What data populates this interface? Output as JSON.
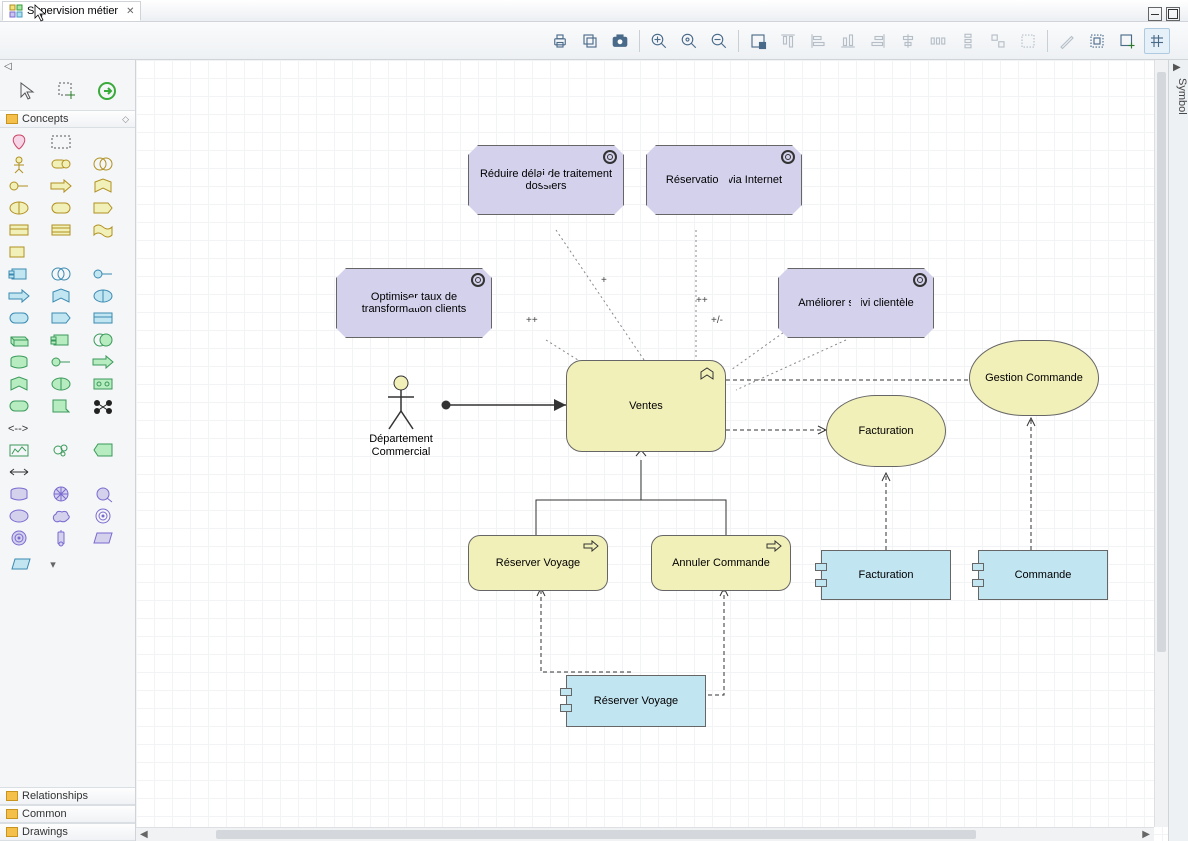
{
  "tab": {
    "title": "Supervision métier"
  },
  "symbol_panel": "Symbol",
  "palette": {
    "concepts": "Concepts",
    "relationships": "Relationships",
    "common": "Common",
    "drawings": "Drawings"
  },
  "annotations": {
    "plus1": "+",
    "plusplus1": "++",
    "plusplus2": "++",
    "plusminus": "+/-"
  },
  "nodes": {
    "goal_reduire": "Réduire délai de traitement dossiers",
    "goal_reservation": "Réservation via Internet",
    "goal_optimiser": "Optimiser taux de transformation clients",
    "goal_ameliorer": "Améliorer suivi clientèle",
    "actor_dept": "Département Commercial",
    "proc_ventes": "Ventes",
    "proc_reserver": "Réserver Voyage",
    "proc_annuler": "Annuler Commande",
    "serv_facturation": "Facturation",
    "serv_gestion": "Gestion Commande",
    "comp_facturation": "Facturation",
    "comp_commande": "Commande",
    "comp_reserver": "Réserver Voyage"
  }
}
